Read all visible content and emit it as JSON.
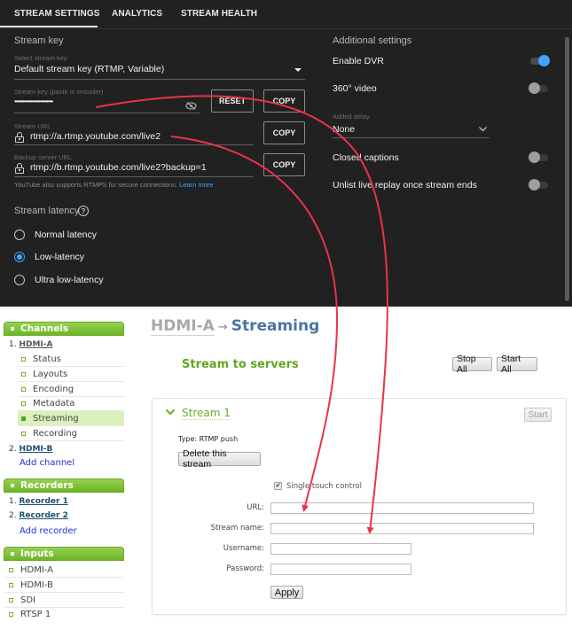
{
  "youtube": {
    "tabs": [
      {
        "label": "STREAM SETTINGS",
        "active": true
      },
      {
        "label": "ANALYTICS",
        "active": false
      },
      {
        "label": "STREAM HEALTH",
        "active": false
      }
    ],
    "stream_key": {
      "section_title": "Stream key",
      "select_label": "Select stream key",
      "select_value": "Default stream key (RTMP, Variable)",
      "key_label": "Stream key (paste in encoder)",
      "key_value_masked": "••••••••••••••••••••••••",
      "reset_label": "RESET",
      "copy_label": "COPY"
    },
    "stream_url": {
      "label": "Stream URL",
      "value": "rtmp://a.rtmp.youtube.com/live2",
      "copy_label": "COPY"
    },
    "backup_url": {
      "label": "Backup server URL",
      "value": "rtmp://b.rtmp.youtube.com/live2?backup=1",
      "copy_label": "COPY"
    },
    "rtmps_note": "YouTube also supports RTMPS for secure connections.",
    "learn_more": "Learn more",
    "latency": {
      "title": "Stream latency",
      "help_icon": "?",
      "options": [
        {
          "label": "Normal latency",
          "selected": false
        },
        {
          "label": "Low-latency",
          "selected": true
        },
        {
          "label": "Ultra low-latency",
          "selected": false
        }
      ]
    },
    "additional": {
      "title": "Additional settings",
      "enable_dvr": {
        "label": "Enable DVR",
        "on": true
      },
      "video_360": {
        "label": "360° video",
        "on": false
      },
      "added_delay": {
        "label": "Added delay",
        "value": "None"
      },
      "closed_captions": {
        "label": "Closed captions",
        "on": false
      },
      "unlist_replay": {
        "label": "Unlist live replay once stream ends",
        "on": false
      }
    },
    "accent_color": "#3ea6ff"
  },
  "sidebar": {
    "channels": {
      "title": "Channels",
      "items": [
        {
          "num": "1.",
          "label": "HDMI-A"
        },
        {
          "num": "2.",
          "label": "HDMI-B"
        }
      ],
      "subitems": [
        {
          "label": "Status",
          "active": false
        },
        {
          "label": "Layouts",
          "active": false
        },
        {
          "label": "Encoding",
          "active": false
        },
        {
          "label": "Metadata",
          "active": false
        },
        {
          "label": "Streaming",
          "active": true
        },
        {
          "label": "Recording",
          "active": false
        }
      ],
      "add_label": "Add channel"
    },
    "recorders": {
      "title": "Recorders",
      "items": [
        {
          "num": "1.",
          "label": "Recorder 1"
        },
        {
          "num": "2.",
          "label": "Recorder 2"
        }
      ],
      "add_label": "Add recorder"
    },
    "inputs": {
      "title": "Inputs",
      "items": [
        "HDMI-A",
        "HDMI-B",
        "SDI",
        "RTSP 1"
      ]
    },
    "accent_color": "#76b33a"
  },
  "main": {
    "breadcrumb": {
      "parent": "HDMI-A",
      "arrow": "→",
      "current": "Streaming"
    },
    "section_title": "Stream to servers",
    "stop_all_label": "Stop All",
    "start_all_label": "Start All",
    "stream": {
      "title": "Stream 1",
      "start_label": "Start",
      "type_label": "Type: RTMP push",
      "delete_label": "Delete this stream",
      "single_touch_label": "Single touch control",
      "single_touch_checked": true,
      "fields": [
        {
          "label": "URL:",
          "value": ""
        },
        {
          "label": "Stream name:",
          "value": ""
        },
        {
          "label": "Username:",
          "value": ""
        },
        {
          "label": "Password:",
          "value": ""
        }
      ],
      "apply_label": "Apply"
    }
  },
  "annotation_arrow_color": "#e8334a"
}
